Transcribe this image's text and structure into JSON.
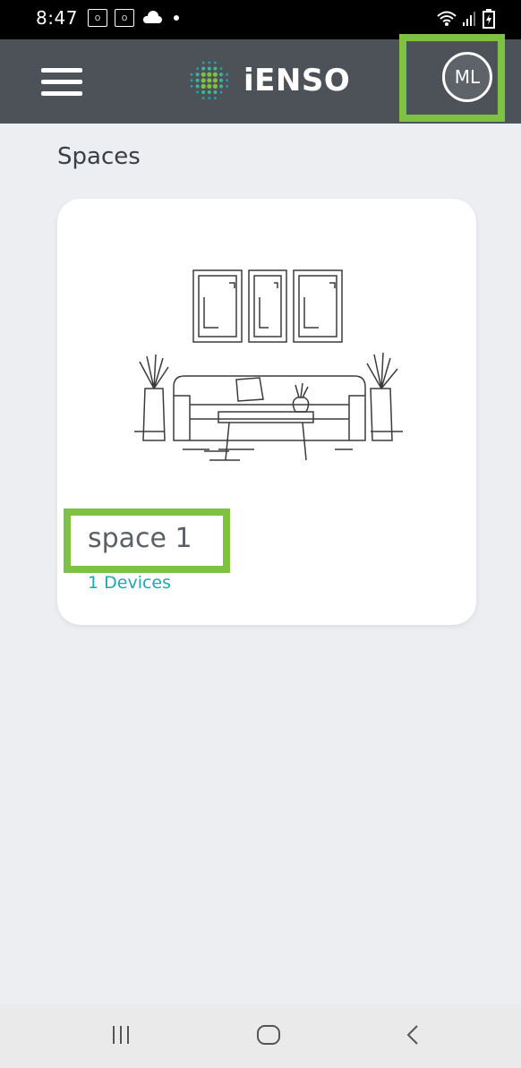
{
  "status_bar": {
    "time": "8:47",
    "notification_icons": [
      "outlook-icon",
      "outlook-icon",
      "cloud-icon",
      "dot-icon"
    ],
    "system_icons": [
      "wifi-icon",
      "signal-icon",
      "battery-icon"
    ]
  },
  "app_bar": {
    "menu_icon": "hamburger-menu-icon",
    "logo_text": "iENSO",
    "avatar_initials": "ML"
  },
  "page": {
    "title": "Spaces"
  },
  "spaces": [
    {
      "name": "space 1",
      "devices": "1 Devices",
      "image": "living-room-illustration"
    }
  ],
  "colors": {
    "app_bar": "#4d5258",
    "background": "#eceef2",
    "accent_teal": "#1ea7ad",
    "highlight_green": "#7dc242"
  },
  "nav_bar": {
    "buttons": [
      "recent-apps-icon",
      "home-icon",
      "back-icon"
    ]
  }
}
